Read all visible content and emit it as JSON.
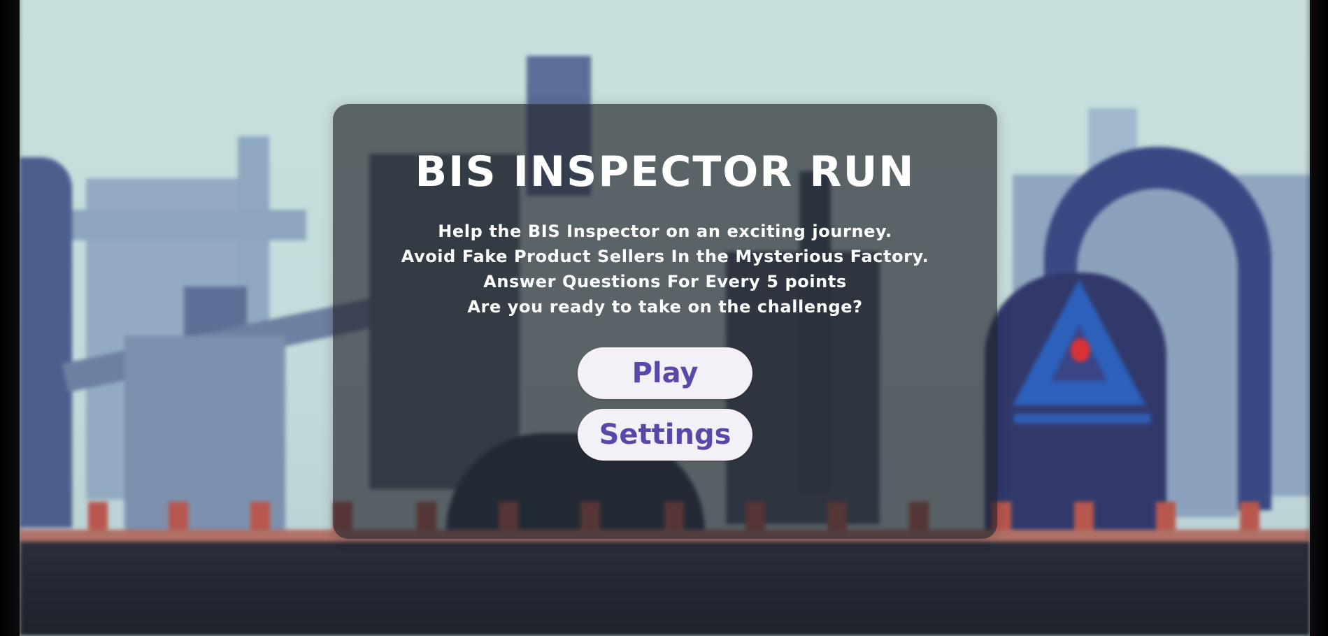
{
  "game": {
    "title": "BIS INSPECTOR RUN",
    "description": [
      "Help the BIS Inspector on an exciting journey.",
      "Avoid Fake Product Sellers In the Mysterious Factory.",
      "Answer Questions For Every 5 points",
      "Are you ready to take on the challenge?"
    ]
  },
  "menu": {
    "play_label": "Play",
    "settings_label": "Settings"
  },
  "colors": {
    "button_text": "#5a48a8",
    "button_background": "#f4f0f8",
    "panel_overlay": "rgba(33, 36, 42, 0.66)"
  }
}
